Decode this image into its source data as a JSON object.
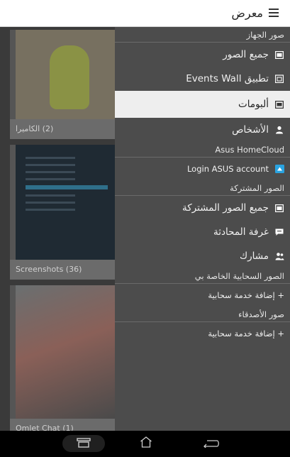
{
  "app": {
    "title": "معرض"
  },
  "gallery": {
    "albums": [
      {
        "label": "(2) الكاميرا"
      },
      {
        "label": "Screenshots (36)"
      },
      {
        "label": "Omlet Chat (1)"
      }
    ]
  },
  "drawer": {
    "device_section": "صور الجهاز",
    "all_photos": "جميع الصور",
    "events_wall": "تطبيق Events Wall",
    "albums": "ألبومات",
    "people": "الأشخاص",
    "homecloud_section": "Asus HomeCloud",
    "login_asus": "Login ASUS account",
    "shared_section": "الصور المشتركة",
    "all_shared": "جميع الصور المشتركة",
    "chat_room": "غرفة المحادثة",
    "share": "مشارك",
    "my_cloud_section": "الصور السحابية الخاصة بي",
    "add_cloud_1": "+ إضافة خدمة سحابية",
    "friends_section": "صور الأصدقاء",
    "add_cloud_2": "+ إضافة خدمة سحابية"
  },
  "colors": {
    "drawer_bg": "#4c4c4c",
    "active_bg": "#eeeeee",
    "homecloud_icon": "#2aa3e0"
  }
}
